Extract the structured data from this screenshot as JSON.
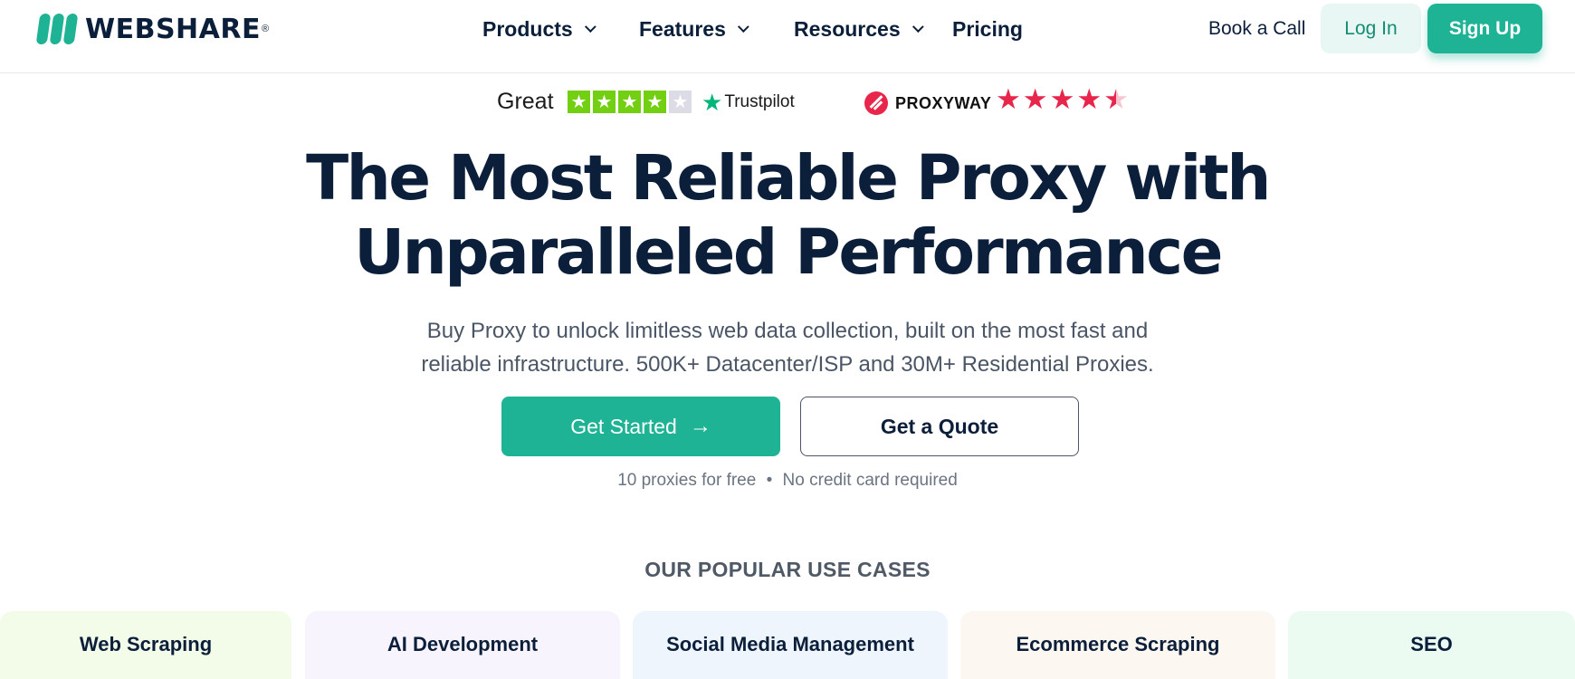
{
  "brand": {
    "name": "WEBSHARE",
    "registered": "®",
    "accent_color": "#1db394"
  },
  "nav": {
    "products": "Products",
    "features": "Features",
    "resources": "Resources",
    "pricing": "Pricing"
  },
  "header_actions": {
    "book_call": "Book a Call",
    "login": "Log In",
    "signup": "Sign Up"
  },
  "ratings": {
    "trustpilot": {
      "label": "Great",
      "stars_filled": 4,
      "stars_total": 5,
      "brand": "Trustpilot",
      "star_color": "#73cf11"
    },
    "proxyway": {
      "brand": "PROXYWAY",
      "rating": 4.5,
      "stars_total": 5,
      "star_color": "#e8254b"
    }
  },
  "hero": {
    "title_line1": "The Most Reliable Proxy with",
    "title_line2": "Unparalleled Performance",
    "subtitle_line1": "Buy Proxy to unlock limitless web data collection, built on the most fast and",
    "subtitle_line2": "reliable infrastructure. 500K+ Datacenter/ISP and 30M+ Residential Proxies.",
    "cta_primary": "Get Started",
    "cta_secondary": "Get a Quote",
    "note_part1": "10 proxies for free",
    "note_separator": "•",
    "note_part2": "No credit card required"
  },
  "use_cases": {
    "heading": "OUR POPULAR USE CASES",
    "items": [
      {
        "label": "Web Scraping",
        "bg": "#f3fbe9"
      },
      {
        "label": "AI Development",
        "bg": "#f8f4fd"
      },
      {
        "label": "Social Media Management",
        "bg": "#eef5fd"
      },
      {
        "label": "Ecommerce Scraping",
        "bg": "#fdf7f1"
      },
      {
        "label": "SEO",
        "bg": "#ecfbf1"
      }
    ]
  }
}
